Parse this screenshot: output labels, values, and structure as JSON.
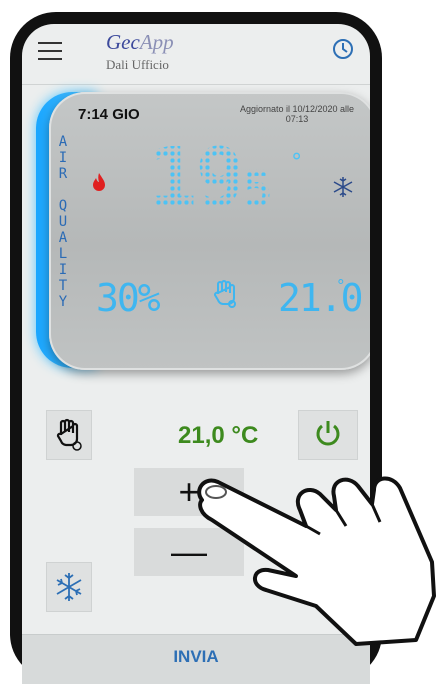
{
  "header": {
    "title_prefix": "Gec",
    "title_suffix": "App",
    "subtitle": "Dali Ufficio",
    "menu_icon": "hamburger-menu-icon",
    "clock_icon": "clock-icon"
  },
  "display": {
    "time": "7:14 GIO",
    "updated_line1": "Aggiornato il 10/12/2020 alle",
    "updated_line2": "07:13",
    "air_quality_letters": [
      "A",
      "I",
      "R",
      " ",
      "Q",
      "U",
      "A",
      "L",
      "I",
      "T",
      "Y"
    ],
    "current_temp": "19",
    "current_temp_decimal": "5",
    "current_temp_unit": "°",
    "humidity": "30%",
    "target_temp": "21.0",
    "target_temp_unit": "°",
    "mode_icons": [
      "flame-icon",
      "snowflake-icon",
      "manual-hand-icon"
    ]
  },
  "controls": {
    "setpoint": "21,0 °C",
    "plus_label": "+",
    "minus_label": "—",
    "send_label": "INVIA"
  },
  "colors": {
    "accent_blue": "#2d6fb5",
    "digit_cyan": "#3fb6f0",
    "setpoint_green": "#3d8a1e",
    "flame_red": "#e02020"
  }
}
